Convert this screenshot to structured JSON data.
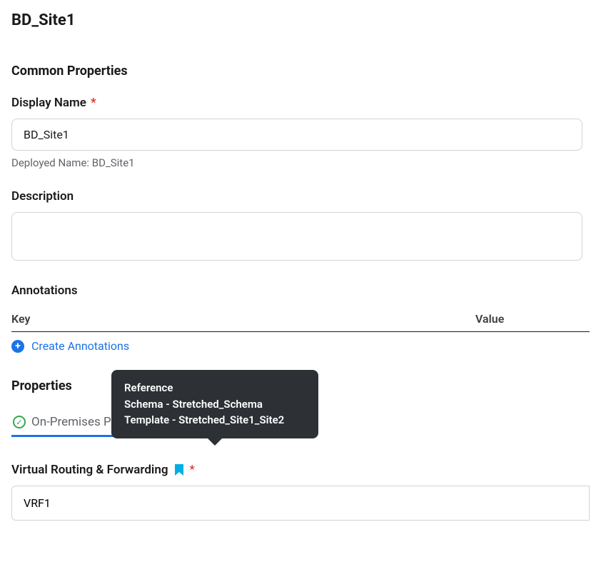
{
  "title": "BD_Site1",
  "sections": {
    "common_properties": {
      "heading": "Common Properties",
      "display_name": {
        "label": "Display Name",
        "value": "BD_Site1",
        "required": true,
        "helper_prefix": "Deployed Name: ",
        "helper_value": "BD_Site1"
      },
      "description": {
        "label": "Description",
        "value": ""
      },
      "annotations": {
        "label": "Annotations",
        "columns": {
          "key": "Key",
          "value": "Value"
        },
        "create_link": "Create Annotations"
      }
    },
    "properties": {
      "heading": "Properties",
      "tab": "On-Premises Properties",
      "tooltip": {
        "line1": "Reference",
        "line2": "Schema - Stretched_Schema",
        "line3": "Template - Stretched_Site1_Site2"
      },
      "vrf": {
        "label": "Virtual Routing & Forwarding",
        "value": "VRF1",
        "required": true
      }
    }
  }
}
